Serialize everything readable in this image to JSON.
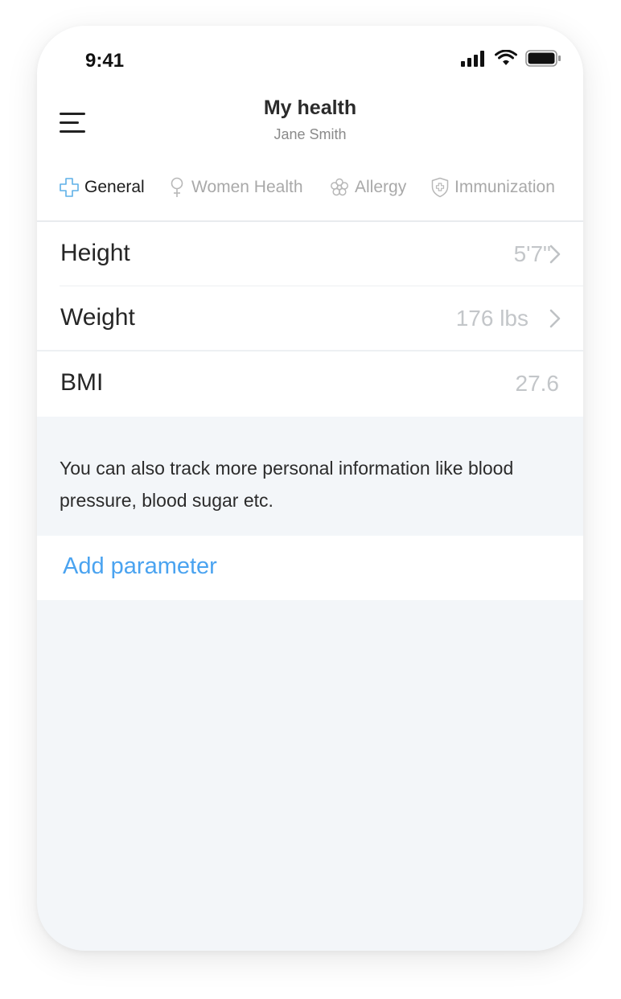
{
  "status_bar": {
    "time": "9:41"
  },
  "header": {
    "title": "My health",
    "subtitle": "Jane Smith"
  },
  "tabs": [
    {
      "label": "General",
      "icon": "medical-cross-icon",
      "active": true
    },
    {
      "label": "Women Health",
      "icon": "female-symbol-icon",
      "active": false
    },
    {
      "label": "Allergy",
      "icon": "flower-icon",
      "active": false
    },
    {
      "label": "Immunization",
      "icon": "shield-cross-icon",
      "active": false
    }
  ],
  "metrics": [
    {
      "label": "Height",
      "value": "5'7\"",
      "has_chevron": true
    },
    {
      "label": "Weight",
      "value": "176 lbs",
      "has_chevron": true
    },
    {
      "label": "BMI",
      "value": "27.6",
      "has_chevron": false
    }
  ],
  "info": {
    "text": "You can also track more personal information like blood pressure, blood sugar etc."
  },
  "actions": {
    "add_parameter": "Add parameter"
  },
  "colors": {
    "accent": "#4aa3f0",
    "background": "#f3f6f9",
    "tab_icon_active": "#5fb0e8"
  }
}
